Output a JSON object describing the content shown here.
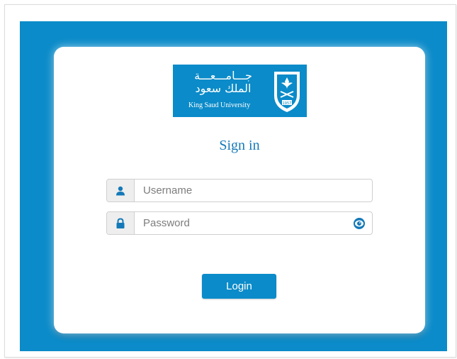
{
  "logo": {
    "arabic_line1": "جـــامـــعـــة",
    "arabic_line2": "الملك سعود",
    "english": "King Saud University",
    "emblem_year": "1957"
  },
  "form": {
    "title": "Sign in",
    "username": {
      "placeholder": "Username",
      "value": "",
      "icon": "user-icon"
    },
    "password": {
      "placeholder": "Password",
      "value": "",
      "icon": "lock-icon",
      "toggle_icon": "eye-icon"
    },
    "login_label": "Login"
  },
  "colors": {
    "brand_blue": "#0b8bc9",
    "title_blue": "#1479b8",
    "page_background": "#ffffff"
  }
}
